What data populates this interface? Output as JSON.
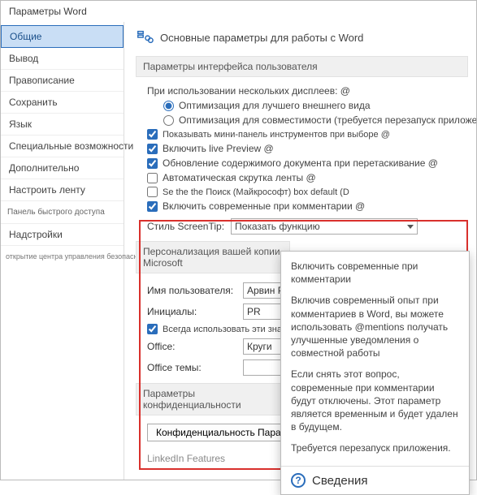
{
  "window": {
    "title": "Параметры Word"
  },
  "sidebar": {
    "items": [
      {
        "label": "Общие",
        "selected": true
      },
      {
        "label": "Вывод"
      },
      {
        "label": "Правописание"
      },
      {
        "label": "Сохранить"
      },
      {
        "label": "Язык"
      },
      {
        "label": "Специальные возможности"
      },
      {
        "label": "Дополнительно"
      },
      {
        "label": "Настроить ленту"
      },
      {
        "label": "Панель быстрого доступа",
        "small": true
      },
      {
        "label": "Надстройки"
      },
      {
        "label": "открытие центра управления безопасности",
        "tiny": true
      }
    ]
  },
  "main": {
    "heading": "Основные параметры для работы с Word",
    "section_ui": "Параметры интерфейса пользователя",
    "multi_display_label": "При использовании нескольких дисплеев: @",
    "radio_best": "Оптимизация для лучшего внешнего вида",
    "radio_compat": "Оптимизация для совместимости (требуется перезапуск приложения)",
    "chk_mini": "Показывать мини-панель инструментов при выборе @",
    "chk_live": "Включить live Preview @",
    "chk_drag": "Обновление содержимого документа при перетаскивание @",
    "chk_collapse": "Автоматическая скрутка ленты @",
    "chk_search": "Se the the Поиск (Майкрософт) box default (D",
    "chk_modern": "Включить современные при комментарии @",
    "screentip_label": "Стиль ScreenTip:",
    "screentip_value": "Показать функцию",
    "section_personal": "Персонализация вашей копии Microsoft",
    "username_label": "Имя пользователя:",
    "username_value": "Арвин Pa d",
    "initials_label": "Инициалы:",
    "initials_value": "PR",
    "chk_always": "Всегда использовать эти значени",
    "office_label": "Office:",
    "office_value": "Круги",
    "theme_label": "Office темы:",
    "theme_value": "",
    "section_privacy": "Параметры конфиденциальности",
    "privacy_button": "Конфиденциальность Параметры...",
    "linkedin": "LinkedIn Features"
  },
  "tooltip": {
    "p1": "Включить современные при комментарии",
    "p2": "Включив современный опыт при комментариев в Word, вы можете использовать @mentions получать улучшенные уведомления о совместной работы",
    "p3": "Если снять этот вопрос, современные при комментарии будут отключены. Этот параметр является временным и будет удален в будущем.",
    "p4": "Требуется перезапуск приложения.",
    "footer": "Сведения"
  }
}
